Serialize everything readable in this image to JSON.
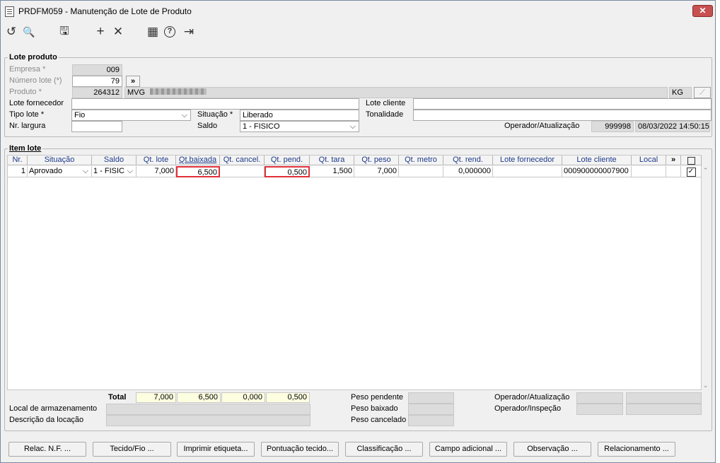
{
  "window": {
    "title": "PRDFM059 - Manutenção de Lote de Produto",
    "close_glyph": "✕"
  },
  "toolbar": {
    "undo_glyph": "↺",
    "search_glyph": "🔍",
    "save_glyph": "🖫",
    "add_glyph": "+",
    "delete_glyph": "✕",
    "calendar_glyph": "▦",
    "help_glyph": "?",
    "exit_glyph": "⇥"
  },
  "lote": {
    "legend": "Lote produto",
    "empresa_label": "Empresa *",
    "empresa_value": "009",
    "numero_label": "Número lote (*)",
    "numero_value": "79",
    "expand_glyph": "»",
    "produto_label": "Produto *",
    "produto_code": "264312",
    "produto_desc": "MVG",
    "produto_unit": "KG",
    "produto_btn_glyph": "⟋",
    "fornecedor_label": "Lote fornecedor",
    "fornecedor_value": "",
    "cliente_label": "Lote cliente",
    "cliente_value": "",
    "tipo_label": "Tipo lote *",
    "tipo_value": "Fio",
    "situacao_label": "Situação *",
    "situacao_value": "Liberado",
    "tonalidade_label": "Tonalidade",
    "tonalidade_value": "",
    "largura_label": "Nr. largura",
    "largura_value": "",
    "saldo_label": "Saldo",
    "saldo_value": "1 - FISICO",
    "operador_label": "Operador/Atualização",
    "operador_value": "999998",
    "operador_date": "08/03/2022 14:50:15"
  },
  "item": {
    "legend": "Item lote",
    "columns": [
      "Nr.",
      "Situação",
      "Saldo",
      "Qt. lote",
      "Qt.baixada",
      "Qt. cancel.",
      "Qt. pend.",
      "Qt. tara",
      "Qt. peso",
      "Qt. metro",
      "Qt. rend.",
      "Lote fornecedor",
      "Lote cliente",
      "Local",
      "»"
    ],
    "row": {
      "nr": "1",
      "situacao": "Aprovado",
      "saldo": "1 - FISIC",
      "qt_lote": "7,000",
      "qt_baixada": "6,500",
      "qt_cancel": "",
      "qt_pend": "0,500",
      "qt_tara": "1,500",
      "qt_peso": "7,000",
      "qt_metro": "",
      "qt_rend": "0,000000",
      "lote_fornecedor": "",
      "lote_cliente": "000900000007900",
      "local": "",
      "checked": "✓"
    }
  },
  "footer": {
    "total_label": "Total",
    "total_lote": "7,000",
    "total_baixada": "6,500",
    "total_cancel": "0,000",
    "total_pend": "0,500",
    "armazenamento_label": "Local de armazenamento",
    "locacao_label": "Descrição da locação",
    "peso_pendente_label": "Peso pendente",
    "peso_baixado_label": "Peso baixado",
    "peso_cancelado_label": "Peso cancelado",
    "operador_atualizacao_label": "Operador/Atualização",
    "operador_inspecao_label": "Operador/Inspeção"
  },
  "buttons": [
    "Relac. N.F. ...",
    "Tecido/Fio ...",
    "Imprimir etiqueta...",
    "Pontuação tecido...",
    "Classificação ...",
    "Campo adicional ...",
    "Observação ...",
    "Relacionamento ..."
  ]
}
